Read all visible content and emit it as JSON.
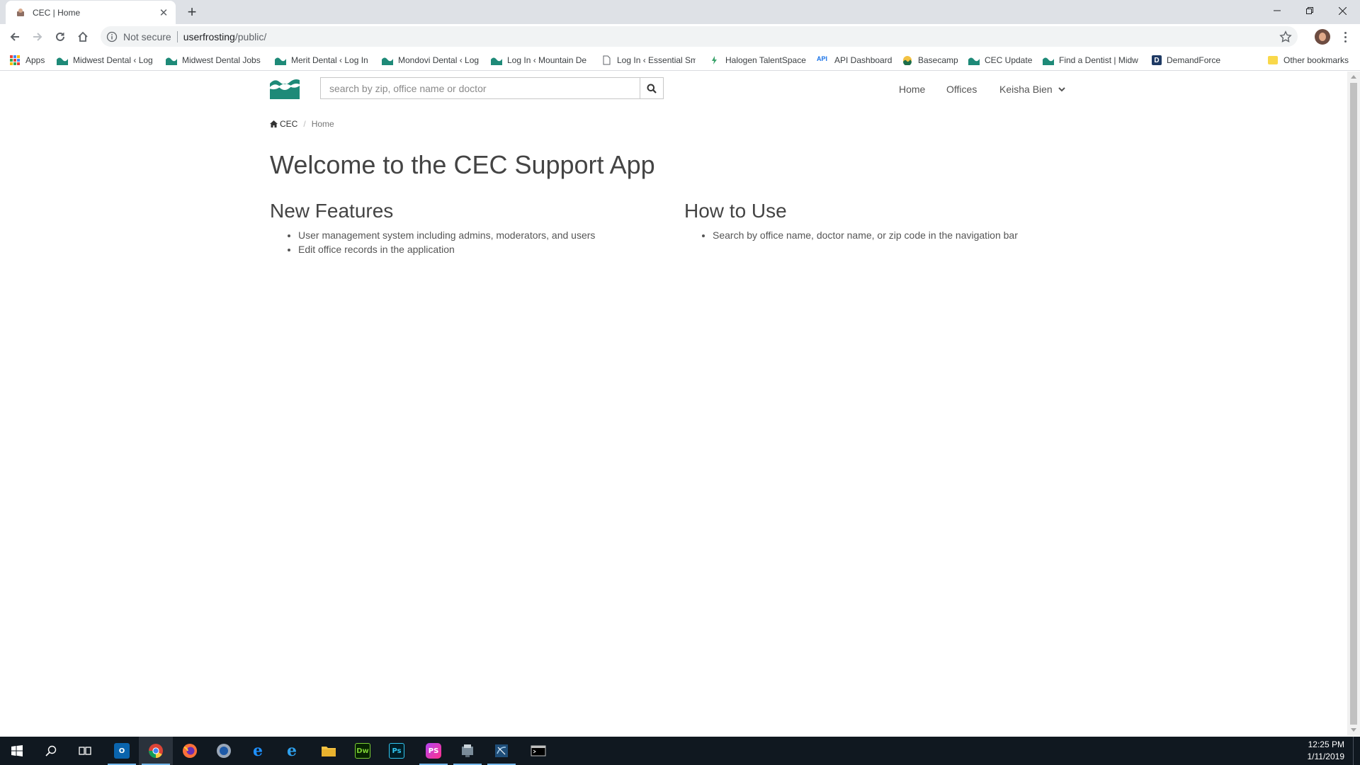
{
  "browser": {
    "tab": {
      "title": "CEC | Home"
    },
    "address": {
      "security": "Not secure",
      "host": "userfrosting",
      "path": "/public/"
    },
    "bookmarks": [
      {
        "label": "Apps",
        "icon": "apps-grid-icon"
      },
      {
        "label": "Midwest Dental ‹ Log",
        "icon": "wave-logo-icon"
      },
      {
        "label": "Midwest Dental Jobs",
        "icon": "wave-logo-icon"
      },
      {
        "label": "Merit Dental ‹ Log In",
        "icon": "wave-logo-icon"
      },
      {
        "label": "Mondovi Dental ‹ Log",
        "icon": "wave-logo-icon"
      },
      {
        "label": "Log In ‹ Mountain De",
        "icon": "wave-logo-icon"
      },
      {
        "label": "Log In ‹ Essential Smi",
        "icon": "page-icon"
      },
      {
        "label": "Halogen TalentSpace",
        "icon": "halogen-icon"
      },
      {
        "label": "API Dashboard",
        "icon": "api-icon"
      },
      {
        "label": "Basecamp",
        "icon": "basecamp-icon"
      },
      {
        "label": "CEC Update",
        "icon": "wave-logo-icon"
      },
      {
        "label": "Find a Dentist | Midw",
        "icon": "wave-logo-icon"
      },
      {
        "label": "DemandForce",
        "icon": "demandforce-icon"
      }
    ],
    "other_bookmarks": "Other bookmarks",
    "api_badge": "API",
    "d_badge": "D"
  },
  "app": {
    "search": {
      "placeholder": "search by zip, office name or doctor"
    },
    "nav": {
      "home": "Home",
      "offices": "Offices",
      "user": "Keisha Bien"
    },
    "breadcrumb": {
      "root": "CEC",
      "current": "Home"
    },
    "title": "Welcome to the CEC Support App",
    "features": {
      "heading": "New Features",
      "items": [
        "User management system including admins, moderators, and users",
        "Edit office records in the application"
      ]
    },
    "howto": {
      "heading": "How to Use",
      "items": [
        "Search by office name, doctor name, or zip code in the navigation bar"
      ]
    },
    "colors": {
      "brand": "#1e8a78",
      "text": "#444444"
    }
  },
  "taskbar": {
    "apps": [
      "windows-start-icon",
      "search-icon",
      "task-view-icon",
      "outlook-icon",
      "chrome-icon",
      "firefox-icon",
      "web-browser-icon",
      "edge-icon",
      "internet-explorer-icon",
      "file-explorer-icon",
      "dreamweaver-icon",
      "photoshop-icon",
      "phpstorm-icon",
      "network-tool-icon",
      "sql-tool-icon",
      "terminal-icon"
    ],
    "labels": {
      "dw": "Dw",
      "ps": "Ps",
      "phpstorm": "PS"
    },
    "time": "12:25 PM",
    "date": "1/11/2019"
  }
}
